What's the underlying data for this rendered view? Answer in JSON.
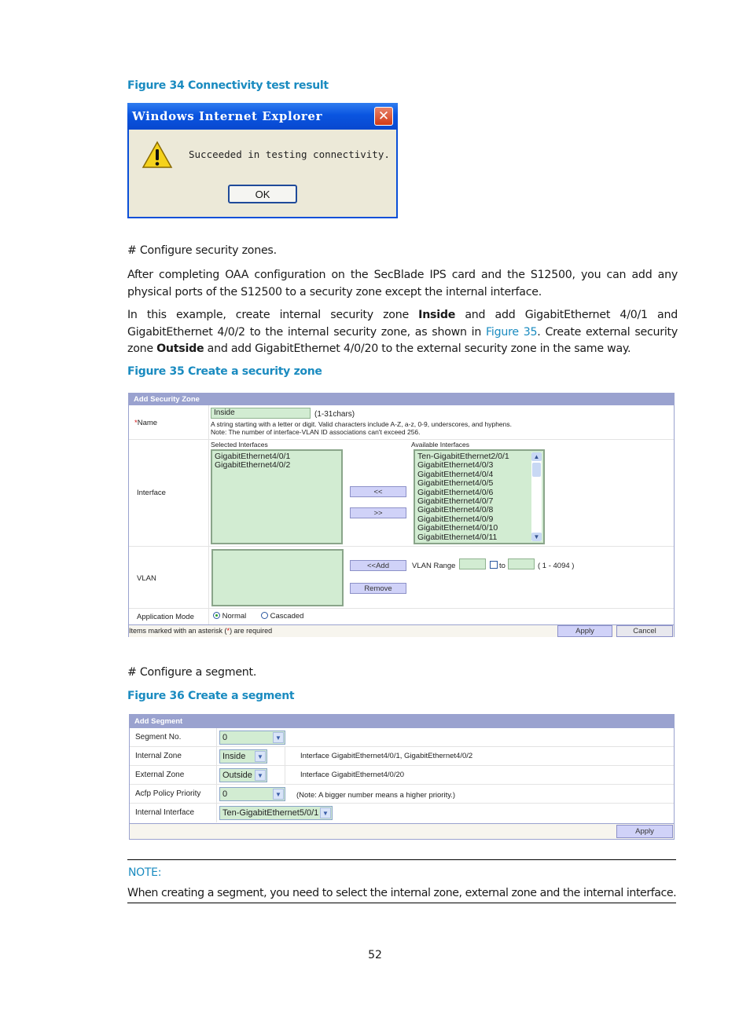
{
  "figure34": {
    "caption": "Figure 34 Connectivity test result",
    "dialog": {
      "title": "Windows Internet Explorer",
      "close_icon": "close-x",
      "warning_icon": "warning-triangle",
      "message": "Succeeded in testing connectivity.",
      "ok_label": "OK"
    }
  },
  "body": {
    "p1": "# Configure security zones.",
    "p2": "After completing OAA configuration on the SecBlade IPS card and the S12500, you can add any physical ports of the S12500 to a security zone except the internal interface.",
    "p3_parts": {
      "a": "In this example, create internal security zone ",
      "b": "Inside",
      "c": " and add GigabitEthernet 4/0/1 and GigabitEthernet 4/0/2 to the internal security zone, as shown in ",
      "link": "Figure 35",
      "d": ". Create external security zone ",
      "e": "Outside",
      "f": " and add GigabitEthernet 4/0/20 to the external security zone in the same way."
    },
    "p4": "# Configure a segment."
  },
  "figure35": {
    "caption": "Figure 35 Create a security zone",
    "panel_title": "Add Security Zone",
    "name": {
      "required_mark": "*",
      "label": "Name",
      "value": "Inside",
      "hint": "(1-31chars)",
      "desc1": "A string starting with a letter or digit. Valid characters include A-Z, a-z, 0-9, underscores, and hyphens.",
      "desc2": "Note: The number of interface-VLAN ID associations can't exceed  256."
    },
    "interface": {
      "label": "Interface",
      "selected_header": "Selected Interfaces",
      "selected": [
        "GigabitEthernet4/0/1",
        "GigabitEthernet4/0/2"
      ],
      "add_label": "<<",
      "remove_label": ">>",
      "available_header": "Available Interfaces",
      "available": [
        "Ten-GigabitEthernet2/0/1",
        "GigabitEthernet4/0/3",
        "GigabitEthernet4/0/4",
        "GigabitEthernet4/0/5",
        "GigabitEthernet4/0/6",
        "GigabitEthernet4/0/7",
        "GigabitEthernet4/0/8",
        "GigabitEthernet4/0/9",
        "GigabitEthernet4/0/10",
        "GigabitEthernet4/0/11"
      ]
    },
    "vlan": {
      "label": "VLAN",
      "add_label": "<<Add",
      "remove_label": "Remove",
      "range_label": "VLAN Range",
      "range_from": "",
      "to_label": "to",
      "range_to": "",
      "range_hint": "( 1 - 4094 )"
    },
    "mode": {
      "label": "Application Mode",
      "options": [
        "Normal",
        "Cascaded"
      ],
      "selected": "Normal"
    },
    "footer": {
      "note_prefix": "Items marked with an asterisk (",
      "note_mark": "*",
      "note_suffix": ") are required",
      "apply_label": "Apply",
      "cancel_label": "Cancel"
    }
  },
  "figure36": {
    "caption": "Figure 36 Create a segment",
    "panel_title": "Add Segment",
    "rows": [
      {
        "label": "Segment No.",
        "value": "0",
        "note": ""
      },
      {
        "label": "Internal Zone",
        "value": "Inside",
        "note": "Interface GigabitEthernet4/0/1, GigabitEthernet4/0/2"
      },
      {
        "label": "External Zone",
        "value": "Outside",
        "note": "Interface GigabitEthernet4/0/20"
      },
      {
        "label": "Acfp Policy Priority",
        "value": "0",
        "note": "(Note: A bigger number means a higher priority.)"
      },
      {
        "label": "Internal Interface",
        "value": "Ten-GigabitEthernet5/0/1",
        "note": ""
      }
    ],
    "apply_label": "Apply"
  },
  "note": {
    "title": "NOTE:",
    "text": "When creating a segment, you need to select the internal zone, external zone and the internal interface."
  },
  "page_number": "52",
  "colors": {
    "caption_blue": "#1a8bc0",
    "panel_header": "#9aa2cf",
    "field_green": "#d2ecd2",
    "button_lilac": "#d0d2f8"
  }
}
